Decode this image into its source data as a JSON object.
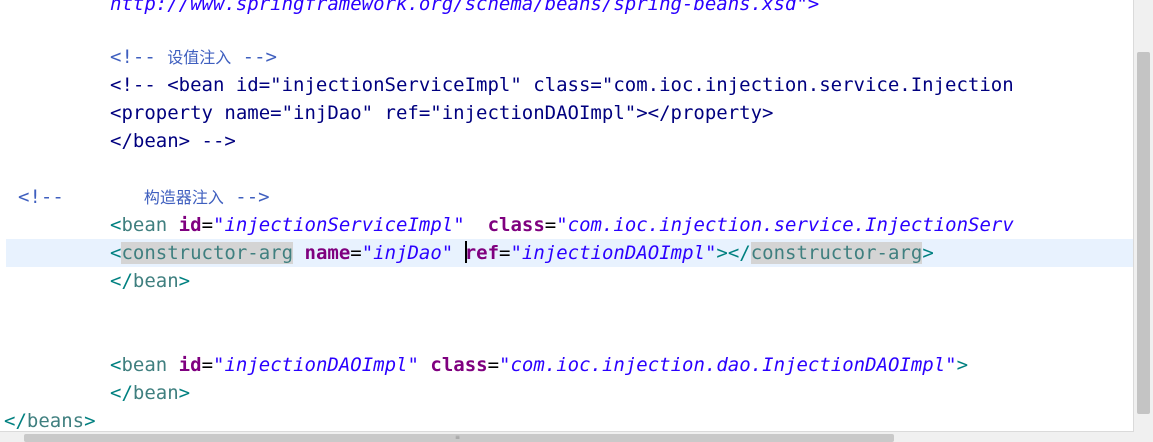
{
  "editor": {
    "line0": "http://www.springframework.org/schema/beans/spring-beans.xsd\">",
    "line1": {
      "open": "<!-- ",
      "cjk": "设值注入",
      "close": " -->"
    },
    "line2": "<!-- <bean id=\"injectionServiceImpl\" class=\"com.ioc.injection.service.Injection",
    "line3": "<property name=\"injDao\" ref=\"injectionDAOImpl\"></property>",
    "line4": "</bean> -->",
    "line5": {
      "open": "<!--       ",
      "cjk": "构造器注入",
      "close": " -->"
    },
    "line6": {
      "tag": "bean",
      "attr1": "id",
      "val1": "\"injectionServiceImpl\"",
      "attr2": "class",
      "val2": "\"com.ioc.injection.service.InjectionServ"
    },
    "line7": {
      "tag": "constructor-arg",
      "attr1": "name",
      "val1": "\"injDao\"",
      "attr2a": "r",
      "attr2b": "ef",
      "val2": "\"injectionDAOImpl\"",
      "endtag": "constructor-arg"
    },
    "line8": {
      "tag": "bean"
    },
    "line9": {
      "tag": "bean",
      "attr1": "id",
      "val1": "\"injectionDAOImpl\"",
      "attr2": "class",
      "val2": "\"com.ioc.injection.dao.InjectionDAOImpl\""
    },
    "line10": {
      "tag": "bean"
    },
    "line11": {
      "tag": "beans"
    },
    "grip": "≡"
  }
}
